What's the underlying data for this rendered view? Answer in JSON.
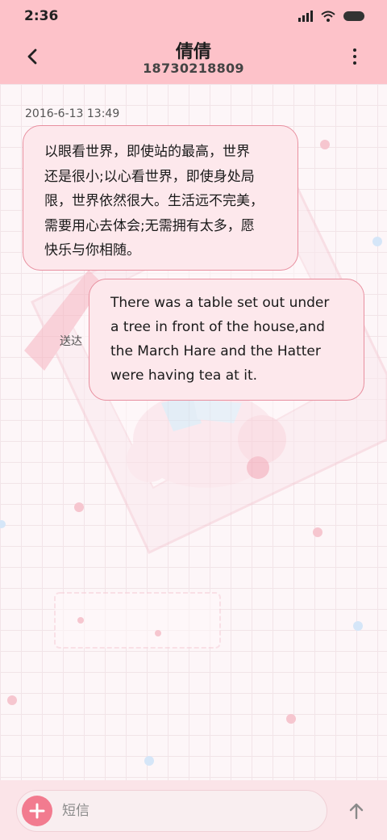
{
  "status_bar": {
    "time": "2:36",
    "icons": [
      "signal-icon",
      "wifi-icon",
      "battery-icon"
    ]
  },
  "header": {
    "contact_name": "倩倩",
    "contact_number": "18730218809",
    "back_icon": "back-arrow-icon",
    "menu_icon": "more-vert-icon"
  },
  "conversation": {
    "timestamp": "2016-6-13 13:49",
    "messages": [
      {
        "direction": "incoming",
        "lines": [
          "以眼看世界，即使站的最高，世界",
          "还是很小;以心看世界，即使身处局",
          "限，世界依然很大。生活远不完美，",
          "需要用心去体会;无需拥有太多，愿",
          "快乐与你相随。"
        ]
      },
      {
        "direction": "outgoing",
        "status": "送达",
        "lines": [
          "There was a table set out under",
          "a tree in front of the house,and",
          "the March Hare and the Hatter",
          "were having tea at it."
        ]
      }
    ]
  },
  "composer": {
    "placeholder": "短信",
    "value": "",
    "add_icon": "plus-icon",
    "send_icon": "send-arrow-up-icon"
  },
  "colors": {
    "header_bg": "#fdc2c9",
    "bubble_bg": "#fde8ec",
    "bubble_border": "#e88f9f",
    "accent": "#f27b8f"
  }
}
